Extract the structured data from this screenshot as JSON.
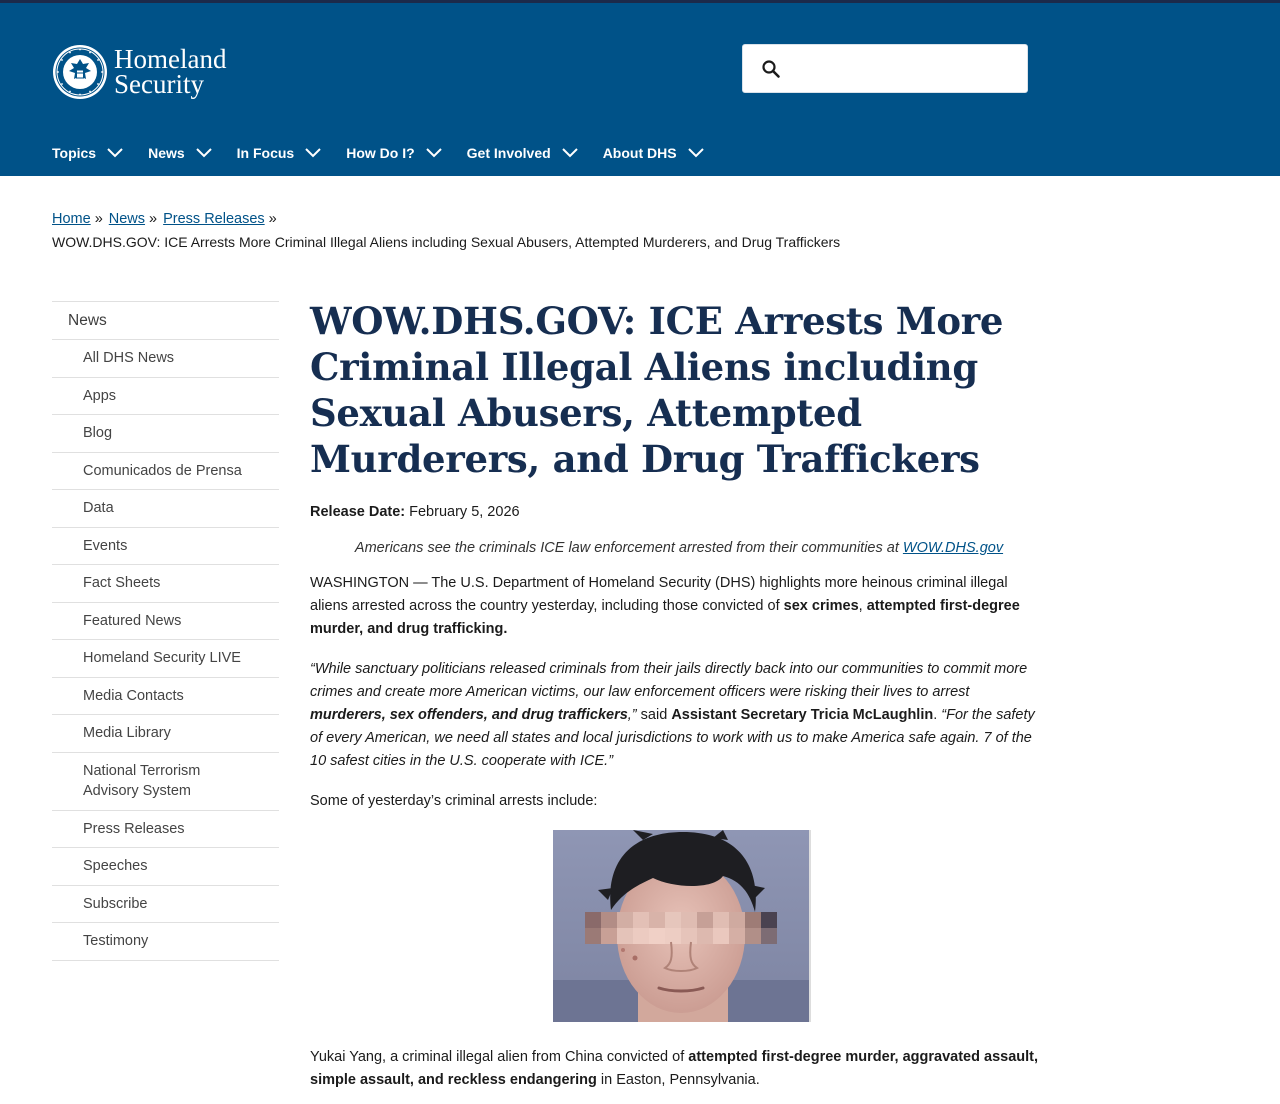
{
  "header": {
    "logo_line1": "Homeland",
    "logo_line2": "Security",
    "seal_text": "U.S. DEPARTMENT OF HOMELAND SECURITY",
    "search": {
      "placeholder": "",
      "value": ""
    },
    "nav": [
      {
        "label": "Topics"
      },
      {
        "label": "News"
      },
      {
        "label": "In Focus"
      },
      {
        "label": "How Do I?"
      },
      {
        "label": "Get Involved"
      },
      {
        "label": "About DHS"
      }
    ]
  },
  "breadcrumb": {
    "links": [
      "Home",
      "News",
      "Press Releases"
    ],
    "separator": "»",
    "current": "WOW.DHS.GOV: ICE Arrests More Criminal Illegal Aliens including Sexual Abusers, Attempted Murderers, and Drug Traffickers"
  },
  "sidebar": {
    "heading": "News",
    "items": [
      "All DHS News",
      "Apps",
      "Blog",
      "Comunicados de Prensa",
      "Data",
      "Events",
      "Fact Sheets",
      "Featured News",
      "Homeland Security LIVE",
      "Media Contacts",
      "Media Library",
      "National Terrorism Advisory System",
      "Press Releases",
      "Speeches",
      "Subscribe",
      "Testimony"
    ]
  },
  "article": {
    "title": "WOW.DHS.GOV: ICE Arrests More Criminal Illegal Aliens including Sexual Abusers, Attempted Murderers, and Drug Traffickers",
    "release_label": "Release Date:",
    "release_date": "February 5, 2026",
    "subtitle_text": "Americans see the criminals ICE law enforcement arrested from their communities at ",
    "subtitle_link": "WOW.DHS.gov",
    "p1": {
      "text": "WASHINGTON — The U.S. Department of Homeland Security (DHS) highlights more heinous criminal illegal aliens arrested across the country yesterday, including those convicted of ",
      "b1": "sex crimes",
      "sep": ", ",
      "b2": "attempted first-degree murder, and drug trafficking."
    },
    "p2": {
      "q1": "“While sanctuary politicians released criminals from their jails directly back into our communities to commit more crimes and create more American victims, our law enforcement officers were risking their lives to arrest ",
      "q1b": "murderers, sex offenders, and drug traffickers",
      "q1end": ",”",
      "said": " said ",
      "speaker": "Assistant Secretary Tricia McLaughlin",
      "dot": ". ",
      "q2": "“For the safety of every American, we need all states and local jurisdictions to work with us to make America safe again. 7 of the 10 safest cities in the U.S. cooperate with ICE.”"
    },
    "p3": "Some of yesterday’s criminal arrests include:",
    "caption": {
      "text": "Yukai Yang, a criminal illegal alien from China convicted of ",
      "bold": "attempted first-degree murder, aggravated assault, simple assault, and reckless endangering",
      "end": " in Easton, Pennsylvania."
    }
  },
  "colors": {
    "header_bg": "#005288",
    "title": "#162e51",
    "link": "#005288"
  }
}
